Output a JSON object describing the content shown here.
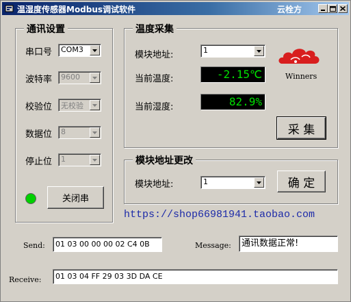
{
  "window": {
    "title": "温湿度传感器Modbus调试软件",
    "brand": "云栓方"
  },
  "comm": {
    "legend": "通讯设置",
    "fields": [
      {
        "label": "串口号",
        "value": "COM3",
        "enabled": true
      },
      {
        "label": "波特率",
        "value": "9600",
        "enabled": false
      },
      {
        "label": "校验位",
        "value": "无校验",
        "enabled": false
      },
      {
        "label": "数据位",
        "value": "8",
        "enabled": false
      },
      {
        "label": "停止位",
        "value": "1",
        "enabled": false
      }
    ],
    "status_color": "#00d000",
    "close_button": "关闭串"
  },
  "acq": {
    "legend": "温度采集",
    "addr_label": "模块地址:",
    "addr_value": "1",
    "temp_label": "当前温度:",
    "temp_value": "-2.15℃",
    "hum_label": "当前湿度:",
    "hum_value": "82.9%",
    "collect_button": "采 集",
    "logo_text": "Winners"
  },
  "addr_change": {
    "legend": "模块地址更改",
    "addr_label": "模块地址:",
    "addr_value": "1",
    "confirm_button": "确 定"
  },
  "shop_link": "https://shop66981941.taobao.com",
  "io": {
    "send_label": "Send:",
    "send_value": "01 03 00 00 00 02 C4 0B",
    "message_label": "Message:",
    "message_value": "通讯数据正常!",
    "receive_label": "Receive:",
    "receive_value": "01 03 04 FF 29 03 3D DA CE"
  },
  "colors": {
    "lcd_text": "#00e000",
    "logo_red": "#d81e1e",
    "link": "#1c2aa8"
  }
}
